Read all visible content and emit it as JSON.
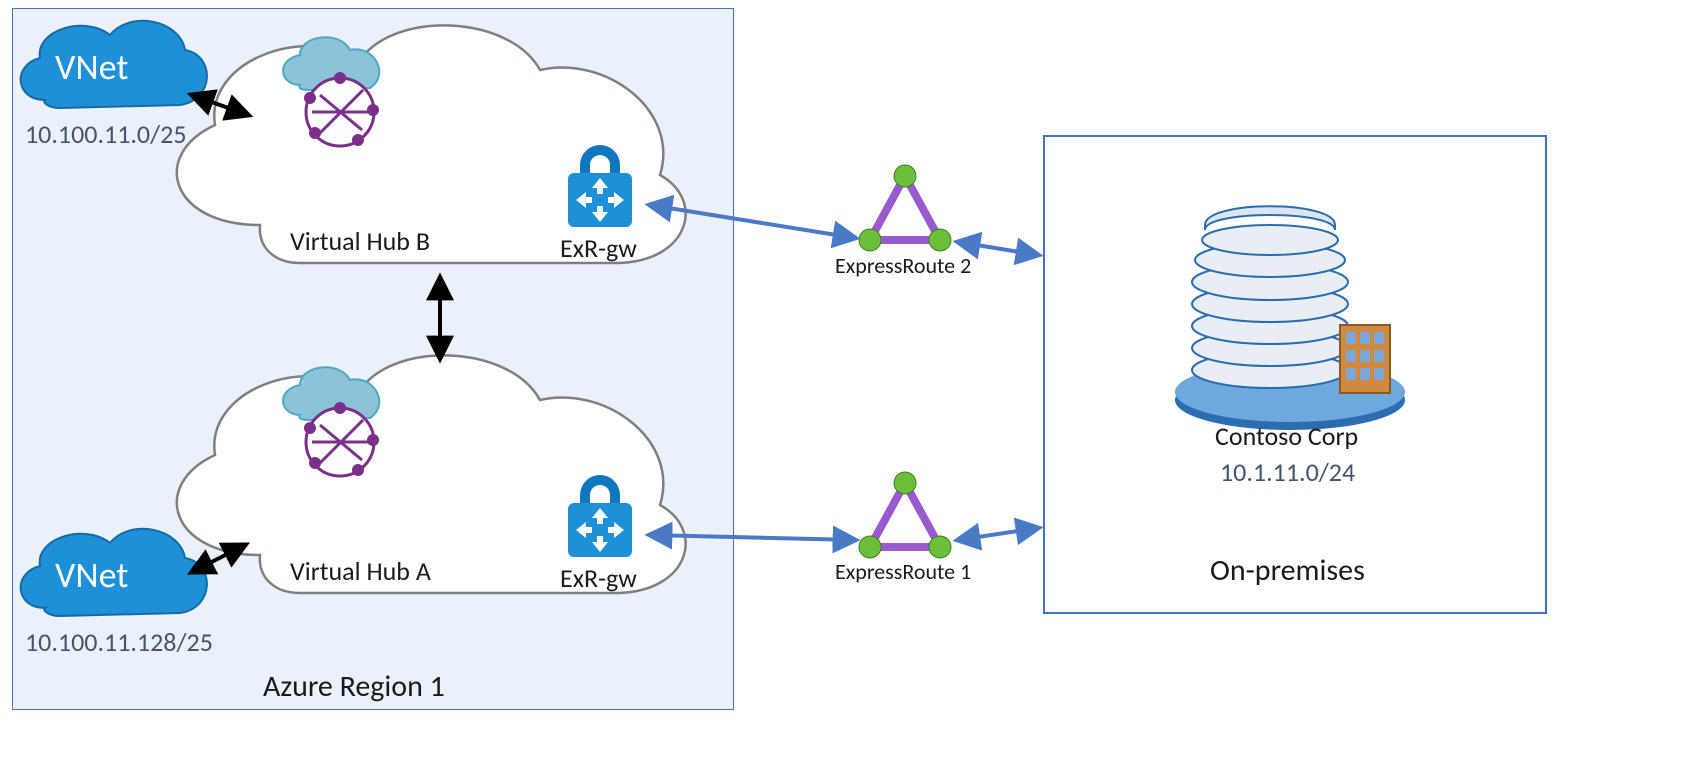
{
  "region": {
    "title": "Azure Region 1"
  },
  "vnet_top": {
    "label": "VNet",
    "cidr": "10.100.11.0/25"
  },
  "vnet_bottom": {
    "label": "VNet",
    "cidr": "10.100.11.128/25"
  },
  "hub_b": {
    "label": "Virtual Hub B",
    "gw": "ExR-gw"
  },
  "hub_a": {
    "label": "Virtual Hub A",
    "gw": "ExR-gw"
  },
  "er2": {
    "label": "ExpressRoute 2"
  },
  "er1": {
    "label": "ExpressRoute 1"
  },
  "onprem": {
    "name": "Contoso Corp",
    "cidr": "10.1.11.0/24",
    "title": "On-premises"
  }
}
